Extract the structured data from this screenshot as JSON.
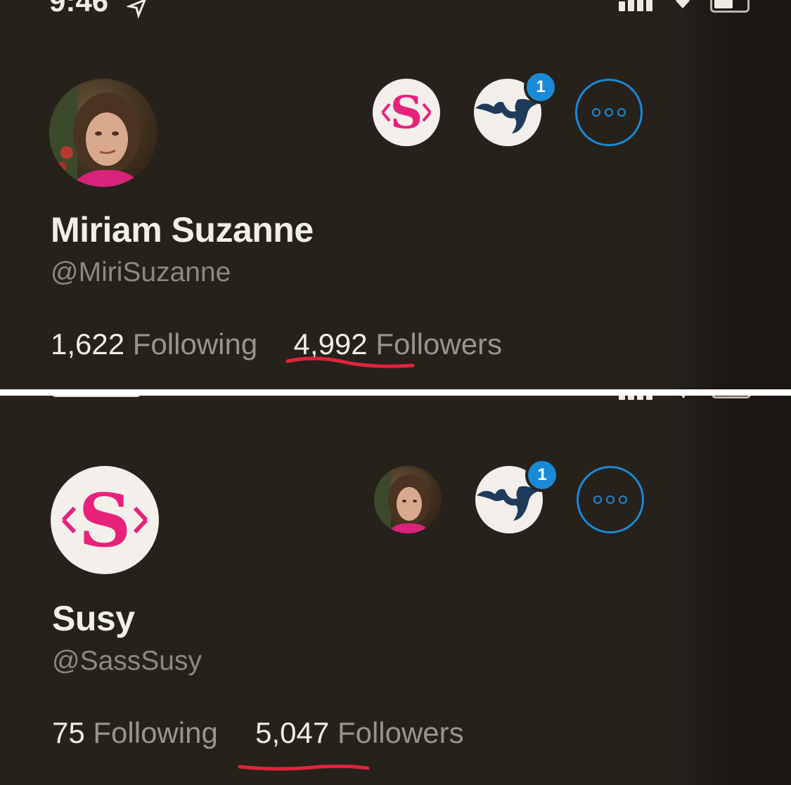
{
  "top_profile": {
    "status_time": "9:46 ",
    "display_name": "Miriam Suzanne",
    "handle": "@MiriSuzanne",
    "following_count": "1,622",
    "following_label": "Following",
    "followers_count": "4,992",
    "followers_label": "Followers",
    "badge_count": "1",
    "profile_logo_letter": "S",
    "profile_logo_brackets_left": "‹",
    "profile_logo_brackets_right": "›"
  },
  "bottom_profile": {
    "display_name": "Susy",
    "handle": "@SassSusy",
    "following_count": "75",
    "following_label": "Following",
    "followers_count": "5,047",
    "followers_label": "Followers",
    "badge_count": "1",
    "profile_logo_letter": "S"
  },
  "colors": {
    "background": "#27211c",
    "accent_blue": "#1a8ad6",
    "logo_pink": "#e8217a",
    "underline_red": "#e0243a",
    "app_icon_navy": "#1f3a5a"
  },
  "icons": {
    "more": "more-options-icon",
    "app": "bat-app-icon",
    "signal": "signal-icon",
    "wifi": "wifi-icon",
    "battery": "battery-icon",
    "location": "location-arrow-icon"
  }
}
